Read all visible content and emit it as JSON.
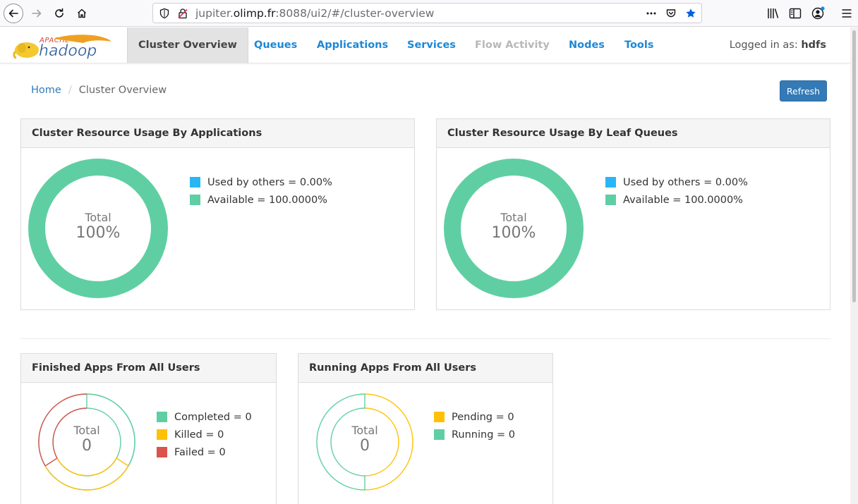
{
  "browser": {
    "url_host_prefix": "jupiter.",
    "url_host": "olimp.fr",
    "url_rest": ":8088/ui2/#/cluster-overview"
  },
  "header": {
    "logo_alt": "APACHE hadoop",
    "nav": [
      {
        "label": "Cluster Overview"
      },
      {
        "label": "Queues"
      },
      {
        "label": "Applications"
      },
      {
        "label": "Services"
      },
      {
        "label": "Flow Activity"
      },
      {
        "label": "Nodes"
      },
      {
        "label": "Tools"
      }
    ],
    "logged_in_prefix": "Logged in as:",
    "user": "hdfs"
  },
  "breadcrumb": {
    "home": "Home",
    "separator": "/",
    "current": "Cluster Overview"
  },
  "refresh_label": "Refresh",
  "panels": {
    "apps_usage": {
      "title": "Cluster Resource Usage By Applications",
      "total_label": "Total",
      "total_value": "100%",
      "legend": [
        "Used by others = 0.00%",
        "Available = 100.0000%"
      ]
    },
    "queues_usage": {
      "title": "Cluster Resource Usage By Leaf Queues",
      "total_label": "Total",
      "total_value": "100%",
      "legend": [
        "Used by others = 0.00%",
        "Available = 100.0000%"
      ]
    },
    "finished": {
      "title": "Finished Apps From All Users",
      "total_label": "Total",
      "total_value": "0",
      "legend": [
        "Completed = 0",
        "Killed = 0",
        "Failed = 0"
      ]
    },
    "running": {
      "title": "Running Apps From All Users",
      "total_label": "Total",
      "total_value": "0",
      "legend": [
        "Pending = 0",
        "Running = 0"
      ]
    }
  },
  "colors": {
    "used": "#29b6f6",
    "available": "#5fcfa3",
    "killed": "#ffc107",
    "failed": "#d9534f",
    "nav_link": "#1e88d6"
  }
}
